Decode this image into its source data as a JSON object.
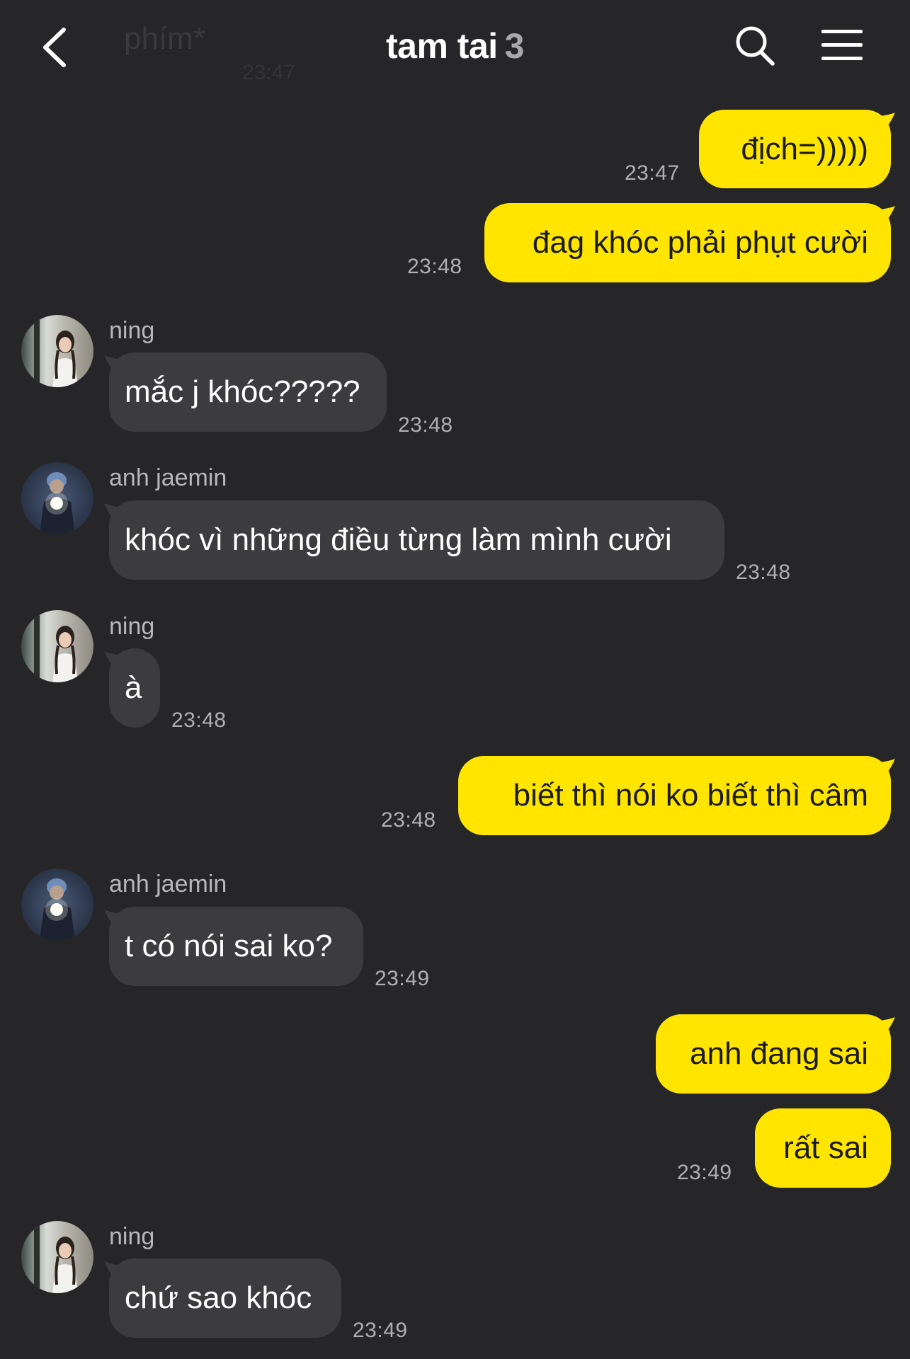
{
  "header": {
    "title": "tam tai",
    "member_count": "3",
    "ghost_text": "phím*",
    "ghost_time": "23:47"
  },
  "colors": {
    "background": "#262628",
    "my_bubble": "#ffe500",
    "their_bubble": "#3c3c3e",
    "timestamp": "#b0b0b2"
  },
  "messages": [
    {
      "side": "me",
      "text": "địch=)))))",
      "time": "23:47"
    },
    {
      "side": "me",
      "text": "đag khóc phải phụt cười",
      "time": "23:48"
    },
    {
      "side": "them",
      "sender": "ning",
      "text": "mắc j khóc?????",
      "time": "23:48"
    },
    {
      "side": "them",
      "sender": "anh jaemin",
      "text": "khóc vì những điều từng làm mình cười",
      "time": "23:48"
    },
    {
      "side": "them",
      "sender": "ning",
      "text": "à",
      "time": "23:48"
    },
    {
      "side": "me",
      "text": "biết thì nói ko biết thì câm",
      "time": "23:48"
    },
    {
      "side": "them",
      "sender": "anh jaemin",
      "text": "t có nói sai ko?",
      "time": "23:49"
    },
    {
      "side": "me",
      "text": "anh đang sai",
      "time": ""
    },
    {
      "side": "me",
      "text": "rất sai",
      "time": "23:49"
    },
    {
      "side": "them",
      "sender": "ning",
      "text": "chứ sao khóc",
      "time": "23:49"
    }
  ]
}
